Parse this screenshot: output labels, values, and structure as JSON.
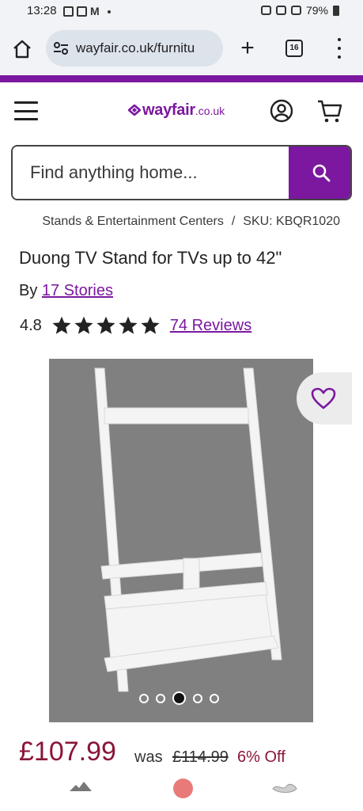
{
  "status_bar": {
    "time": "13:28",
    "battery": "79%"
  },
  "browser": {
    "url": "wayfair.co.uk/furnitu",
    "tab_count": "16"
  },
  "header": {
    "logo_text": "wayfair",
    "logo_tld": ".co.uk",
    "brand_color": "#7b189f"
  },
  "search": {
    "placeholder": "Find anything home..."
  },
  "breadcrumb": {
    "category": "Stands & Entertainment Centers",
    "separator": "/",
    "sku": "SKU: KBQR1020"
  },
  "product": {
    "title": "Duong TV Stand for TVs up to 42\"",
    "by_label": "By",
    "brand": "17 Stories",
    "rating": "4.8",
    "stars": 5,
    "reviews": "74 Reviews",
    "gallery_dots": 5,
    "active_dot": 3
  },
  "pricing": {
    "price": "£107.99",
    "was_label": "was",
    "was_price": "£114.99",
    "discount": "6% Off",
    "price_color": "#8b1538"
  }
}
